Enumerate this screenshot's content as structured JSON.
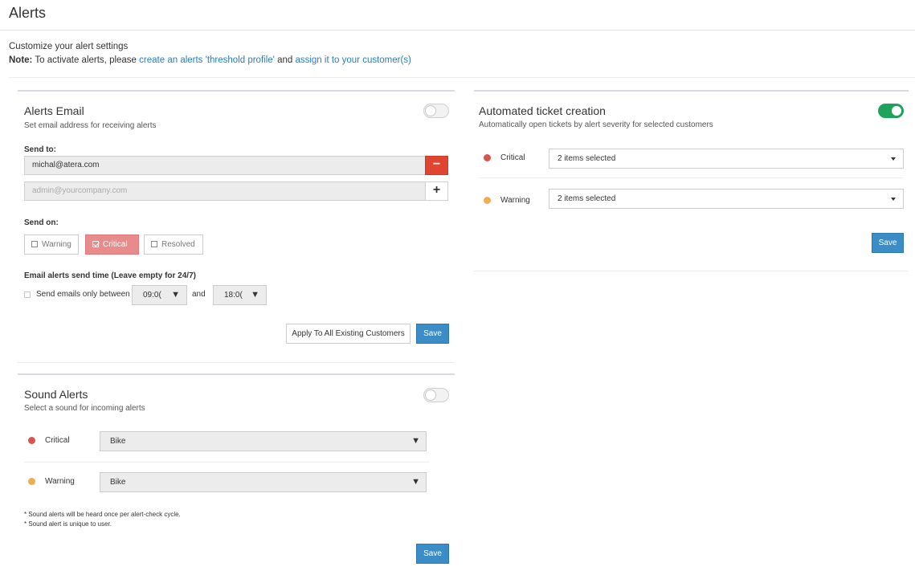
{
  "page": {
    "title": "Alerts"
  },
  "intro": {
    "line1": "Customize your alert settings",
    "note_label": "Note:",
    "note_text": "To activate alerts, please",
    "link1": "create an alerts 'threshold profile'",
    "and": "and",
    "link2": "assign it to your customer(s)"
  },
  "alerts_email": {
    "title": "Alerts Email",
    "subtitle": "Set email address for receiving alerts",
    "enabled": false,
    "send_to_label": "Send to:",
    "email_value": "michal@atera.com",
    "email_placeholder": "admin@yourcompany.com",
    "remove_label": "−",
    "add_label": "+",
    "send_on_label": "Send on:",
    "send_on": [
      {
        "label": "Warning",
        "checked": false
      },
      {
        "label": "Critical",
        "checked": true
      },
      {
        "label": "Resolved",
        "checked": false
      }
    ],
    "send_time_label": "Email alerts send time (Leave empty for 24/7)",
    "between_label": "Send emails only between",
    "start_time": "09:0(",
    "and_label": "and",
    "end_time": "18:0(",
    "caret": "▼",
    "apply_all_label": "Apply To All Existing Customers",
    "save_label": "Save"
  },
  "sound_alerts": {
    "title": "Sound Alerts",
    "subtitle": "Select a sound for incoming alerts",
    "enabled": false,
    "rows": [
      {
        "severity": "Critical",
        "sound": "Bike",
        "color": "#d9534f"
      },
      {
        "severity": "Warning",
        "sound": "Bike",
        "color": "#f0ad4e"
      }
    ],
    "note1": "* Sound alerts will be heard once per alert-check cycle.",
    "note2": "* Sound alert is unique to user.",
    "save_label": "Save"
  },
  "ticket_creation": {
    "title": "Automated ticket creation",
    "subtitle": "Automatically open tickets by alert severity for selected customers",
    "enabled": true,
    "rows": [
      {
        "severity": "Critical",
        "selection": "2 items selected",
        "color": "#d9534f"
      },
      {
        "severity": "Warning",
        "selection": "2 items selected",
        "color": "#f0ad4e"
      }
    ],
    "save_label": "Save"
  },
  "colors": {
    "primary": "#3a8dc6",
    "danger": "#e0452f",
    "critical_active": "#e88b8b",
    "toggle_on": "#1fa35a"
  }
}
